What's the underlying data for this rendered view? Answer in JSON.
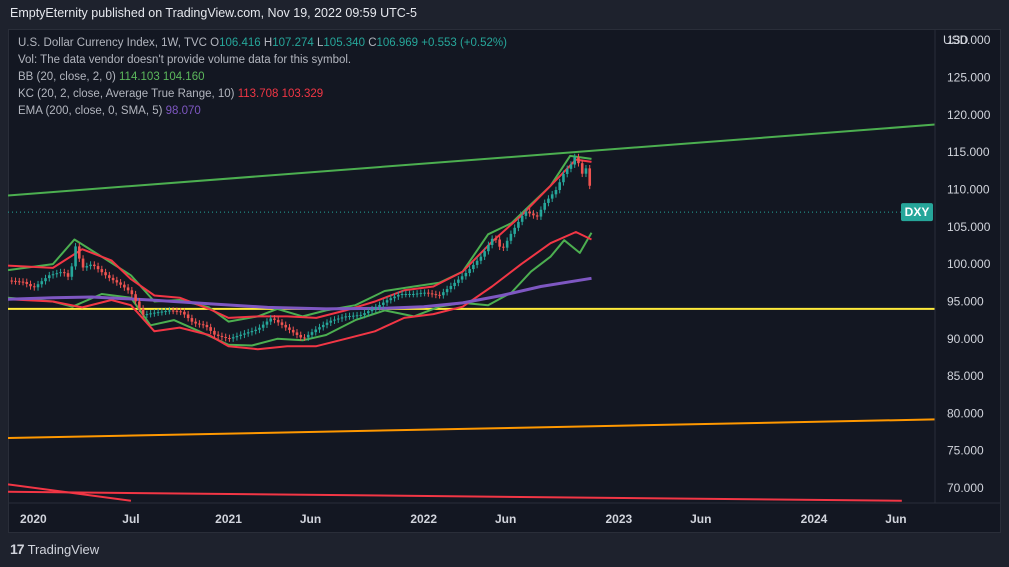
{
  "header": {
    "title": "EmptyEternity published on TradingView.com, Nov 19, 2022 09:59 UTC-5"
  },
  "legend": {
    "symbol": "U.S. Dollar Currency Index, 1W, TVC",
    "o_label": "O",
    "o": "106.416",
    "h_label": "H",
    "h": "107.274",
    "l_label": "L",
    "l": "105.340",
    "c_label": "C",
    "c": "106.969",
    "change": "+0.553 (+0.52%)",
    "vol": "Vol: The data vendor doesn't provide volume data for this symbol.",
    "bb_label": "BB (20, close, 2, 0)",
    "bb_upper": "114.103",
    "bb_lower": "104.160",
    "kc_label": "KC (20, 2, close, Average True Range, 10)",
    "kc_upper": "113.708",
    "kc_lower": "103.329",
    "ema_label": "EMA (200, close, 0, SMA, 5)",
    "ema": "98.070"
  },
  "footer": {
    "brand": "TradingView"
  },
  "colors": {
    "up": "#26a69a",
    "down": "#ef5350",
    "bb": "#4caf50",
    "kc": "#f23645",
    "ema": "#7e57c2",
    "trend_green": "#4caf50",
    "support_yellow": "#ffeb3b",
    "trend_orange": "#ff9800",
    "trend_red": "#f23645"
  },
  "chart_data": {
    "type": "line",
    "title": "U.S. Dollar Currency Index, 1W, TVC",
    "currency": "USD",
    "symbol_tag": "DXY",
    "last_price": 106.969,
    "y_ticks": [
      "130.000",
      "125.000",
      "120.000",
      "115.000",
      "110.000",
      "105.000",
      "100.000",
      "95.000",
      "90.000",
      "85.000",
      "80.000",
      "75.000",
      "70.000"
    ],
    "ylim": [
      68,
      131.5
    ],
    "x_ticks": [
      {
        "label": "2020",
        "t": 2020.0
      },
      {
        "label": "Jul",
        "t": 2020.5
      },
      {
        "label": "2021",
        "t": 2021.0
      },
      {
        "label": "Jun",
        "t": 2021.42
      },
      {
        "label": "2022",
        "t": 2022.0
      },
      {
        "label": "Jun",
        "t": 2022.42
      },
      {
        "label": "2023",
        "t": 2023.0
      },
      {
        "label": "Jun",
        "t": 2023.42
      },
      {
        "label": "2024",
        "t": 2024.0
      },
      {
        "label": "Jun",
        "t": 2024.42
      }
    ],
    "xlim": [
      2019.87,
      2024.62
    ],
    "price_path": [
      [
        2019.87,
        97.8
      ],
      [
        2019.95,
        97.6
      ],
      [
        2020.0,
        96.8
      ],
      [
        2020.08,
        98.5
      ],
      [
        2020.15,
        99.0
      ],
      [
        2020.19,
        98.0
      ],
      [
        2020.21,
        102.9
      ],
      [
        2020.25,
        99.5
      ],
      [
        2020.3,
        100.0
      ],
      [
        2020.38,
        98.3
      ],
      [
        2020.45,
        97.2
      ],
      [
        2020.5,
        96.2
      ],
      [
        2020.56,
        93.2
      ],
      [
        2020.62,
        93.5
      ],
      [
        2020.7,
        93.8
      ],
      [
        2020.76,
        93.6
      ],
      [
        2020.82,
        92.1
      ],
      [
        2020.88,
        91.8
      ],
      [
        2020.93,
        90.5
      ],
      [
        2021.0,
        90.0
      ],
      [
        2021.08,
        90.7
      ],
      [
        2021.15,
        91.3
      ],
      [
        2021.22,
        92.8
      ],
      [
        2021.3,
        91.4
      ],
      [
        2021.38,
        90.0
      ],
      [
        2021.45,
        91.3
      ],
      [
        2021.52,
        92.4
      ],
      [
        2021.6,
        93.0
      ],
      [
        2021.68,
        93.2
      ],
      [
        2021.76,
        94.3
      ],
      [
        2021.82,
        95.3
      ],
      [
        2021.88,
        96.0
      ],
      [
        2021.95,
        96.0
      ],
      [
        2022.0,
        96.2
      ],
      [
        2022.08,
        95.8
      ],
      [
        2022.15,
        97.3
      ],
      [
        2022.22,
        98.9
      ],
      [
        2022.3,
        101.2
      ],
      [
        2022.36,
        103.8
      ],
      [
        2022.4,
        101.8
      ],
      [
        2022.45,
        104.2
      ],
      [
        2022.52,
        107.1
      ],
      [
        2022.58,
        106.3
      ],
      [
        2022.62,
        108.2
      ],
      [
        2022.68,
        110.0
      ],
      [
        2022.72,
        112.3
      ],
      [
        2022.76,
        113.5
      ],
      [
        2022.78,
        114.7
      ],
      [
        2022.81,
        112.0
      ],
      [
        2022.83,
        113.0
      ],
      [
        2022.85,
        110.8
      ],
      [
        2022.86,
        106.9
      ]
    ],
    "series": [
      {
        "name": "BB upper",
        "values": [
          [
            2019.87,
            99.2
          ],
          [
            2020.1,
            100.0
          ],
          [
            2020.21,
            103.3
          ],
          [
            2020.35,
            101.0
          ],
          [
            2020.5,
            98.5
          ],
          [
            2020.62,
            95.0
          ],
          [
            2020.75,
            95.2
          ],
          [
            2020.9,
            94.2
          ],
          [
            2021.0,
            92.3
          ],
          [
            2021.15,
            93.0
          ],
          [
            2021.25,
            94.0
          ],
          [
            2021.38,
            93.0
          ],
          [
            2021.5,
            93.8
          ],
          [
            2021.65,
            94.5
          ],
          [
            2021.8,
            96.4
          ],
          [
            2021.95,
            97.0
          ],
          [
            2022.08,
            97.5
          ],
          [
            2022.2,
            99.0
          ],
          [
            2022.33,
            104.0
          ],
          [
            2022.45,
            105.5
          ],
          [
            2022.55,
            108.0
          ],
          [
            2022.65,
            110.5
          ],
          [
            2022.75,
            114.5
          ],
          [
            2022.86,
            114.1
          ]
        ]
      },
      {
        "name": "BB lower",
        "values": [
          [
            2019.87,
            95.5
          ],
          [
            2020.1,
            95.0
          ],
          [
            2020.2,
            94.3
          ],
          [
            2020.35,
            96.0
          ],
          [
            2020.5,
            95.5
          ],
          [
            2020.6,
            91.8
          ],
          [
            2020.72,
            92.5
          ],
          [
            2020.85,
            91.0
          ],
          [
            2021.0,
            89.2
          ],
          [
            2021.12,
            89.1
          ],
          [
            2021.25,
            90.0
          ],
          [
            2021.38,
            89.8
          ],
          [
            2021.5,
            90.5
          ],
          [
            2021.65,
            92.5
          ],
          [
            2021.8,
            93.8
          ],
          [
            2021.95,
            93.0
          ],
          [
            2022.08,
            94.3
          ],
          [
            2022.2,
            94.8
          ],
          [
            2022.33,
            94.5
          ],
          [
            2022.45,
            96.2
          ],
          [
            2022.55,
            99.0
          ],
          [
            2022.65,
            101.0
          ],
          [
            2022.72,
            103.2
          ],
          [
            2022.8,
            101.5
          ],
          [
            2022.86,
            104.2
          ]
        ]
      },
      {
        "name": "KC upper",
        "values": [
          [
            2019.87,
            99.8
          ],
          [
            2020.1,
            99.5
          ],
          [
            2020.25,
            102.0
          ],
          [
            2020.4,
            100.5
          ],
          [
            2020.5,
            98.0
          ],
          [
            2020.62,
            95.8
          ],
          [
            2020.75,
            95.5
          ],
          [
            2020.9,
            94.0
          ],
          [
            2021.0,
            92.8
          ],
          [
            2021.15,
            93.0
          ],
          [
            2021.3,
            93.0
          ],
          [
            2021.45,
            92.8
          ],
          [
            2021.6,
            93.8
          ],
          [
            2021.75,
            95.0
          ],
          [
            2021.9,
            96.5
          ],
          [
            2022.05,
            97.0
          ],
          [
            2022.2,
            99.0
          ],
          [
            2022.35,
            103.0
          ],
          [
            2022.5,
            106.5
          ],
          [
            2022.65,
            110.5
          ],
          [
            2022.78,
            114.0
          ],
          [
            2022.86,
            113.7
          ]
        ]
      },
      {
        "name": "KC lower",
        "values": [
          [
            2019.87,
            95.3
          ],
          [
            2020.1,
            95.0
          ],
          [
            2020.25,
            94.2
          ],
          [
            2020.4,
            95.2
          ],
          [
            2020.5,
            94.5
          ],
          [
            2020.62,
            91.0
          ],
          [
            2020.75,
            91.5
          ],
          [
            2020.9,
            90.5
          ],
          [
            2021.0,
            89.0
          ],
          [
            2021.15,
            88.6
          ],
          [
            2021.3,
            89.0
          ],
          [
            2021.45,
            89.0
          ],
          [
            2021.6,
            90.0
          ],
          [
            2021.75,
            91.0
          ],
          [
            2021.9,
            92.8
          ],
          [
            2022.05,
            93.3
          ],
          [
            2022.2,
            94.3
          ],
          [
            2022.35,
            97.0
          ],
          [
            2022.5,
            100.0
          ],
          [
            2022.65,
            102.8
          ],
          [
            2022.78,
            104.3
          ],
          [
            2022.86,
            103.3
          ]
        ]
      },
      {
        "name": "EMA",
        "values": [
          [
            2019.87,
            95.3
          ],
          [
            2020.1,
            95.5
          ],
          [
            2020.3,
            95.6
          ],
          [
            2020.6,
            95.2
          ],
          [
            2020.9,
            94.7
          ],
          [
            2021.2,
            94.2
          ],
          [
            2021.5,
            94.0
          ],
          [
            2021.8,
            94.1
          ],
          [
            2022.0,
            94.3
          ],
          [
            2022.2,
            94.8
          ],
          [
            2022.4,
            95.8
          ],
          [
            2022.6,
            97.0
          ],
          [
            2022.86,
            98.1
          ]
        ]
      }
    ],
    "trendlines": [
      {
        "name": "green resistance",
        "points": [
          [
            2019.87,
            109.2
          ],
          [
            2024.62,
            118.7
          ]
        ]
      },
      {
        "name": "yellow support",
        "points": [
          [
            2019.87,
            94.0
          ],
          [
            2024.62,
            94.0
          ]
        ]
      },
      {
        "name": "orange trend",
        "points": [
          [
            2019.87,
            76.7
          ],
          [
            2024.62,
            79.2
          ]
        ]
      },
      {
        "name": "red trend A",
        "points": [
          [
            2019.87,
            70.5
          ],
          [
            2020.5,
            68.3
          ]
        ]
      },
      {
        "name": "red trend B",
        "points": [
          [
            2019.87,
            69.5
          ],
          [
            2024.45,
            68.3
          ]
        ]
      }
    ]
  }
}
